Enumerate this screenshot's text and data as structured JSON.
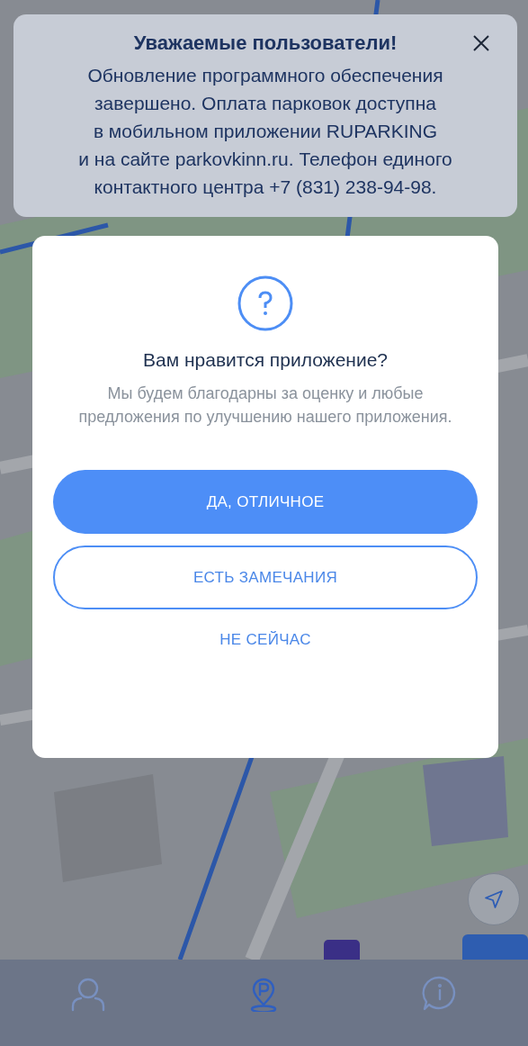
{
  "notice": {
    "title": "Уважаемые пользователи!",
    "message_lines": [
      "Обновление программного обеспечения",
      "завершено. Оплата парковок доступна",
      "в мобильном приложении RUPARKING",
      "и на сайте parkovkinn.ru. Телефон единого",
      "контактного центра +7 (831) 238-94-98."
    ]
  },
  "rating_dialog": {
    "title": "Вам нравится приложение?",
    "message": "Мы будем благодарны за оценку и любые предложения по улучшению нашего приложения.",
    "buttons": [
      {
        "label": "ДА, ОТЛИЧНОЕ",
        "kind": "primary"
      },
      {
        "label": "ЕСТЬ ЗАМЕЧАНИЯ",
        "kind": "outline"
      },
      {
        "label": "НЕ СЕЙЧАС",
        "kind": "text"
      }
    ]
  },
  "tab_bar": [
    {
      "kind": "profile",
      "selected": false
    },
    {
      "kind": "parking",
      "selected": true
    },
    {
      "kind": "info",
      "selected": false
    }
  ]
}
